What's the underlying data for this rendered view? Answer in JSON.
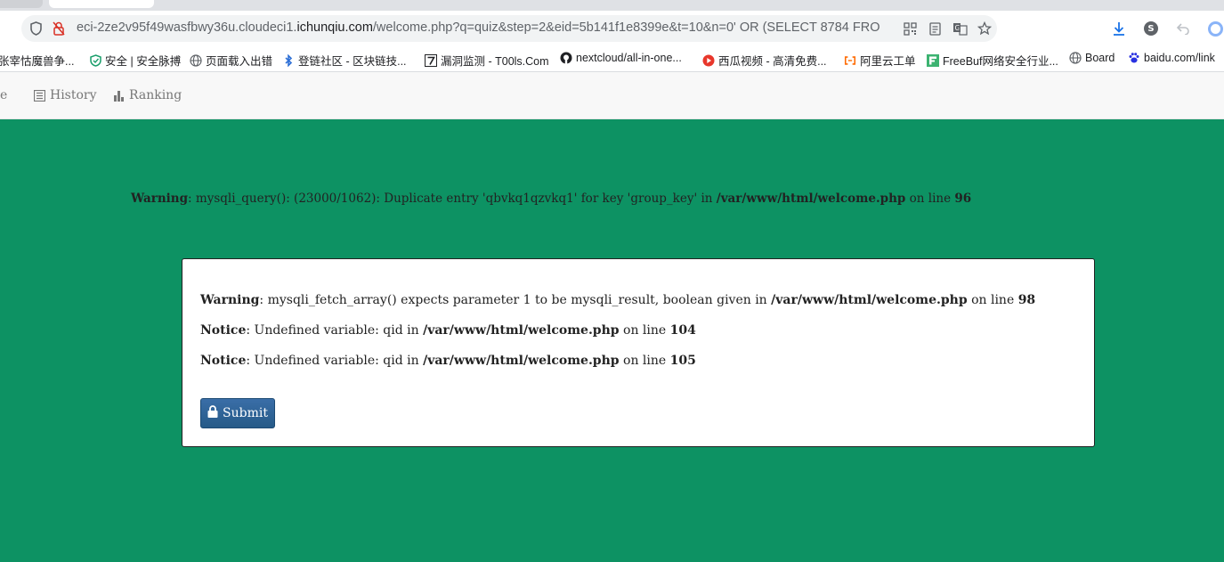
{
  "browser": {
    "url_prefix": "eci-2ze2v95f49wasfbwy36u.cloudeci1.",
    "url_domain": "ichunqiu.com",
    "url_path": "/welcome.php?q=quiz&step=2&eid=5b141f1e8399e&t=10&n=0' OR (SELECT 8784 FRO",
    "profile_initial": "S"
  },
  "bookmarks": [
    {
      "label": "张宰怙魔兽争...",
      "icon": "none"
    },
    {
      "label": "安全 | 安全脉搏",
      "icon": "shield-icon"
    },
    {
      "label": "页面载入出错",
      "icon": "globe-icon"
    },
    {
      "label": "登链社区 - 区块链技...",
      "icon": "bluetooth-icon"
    },
    {
      "label": "漏洞监测 - T00ls.Com",
      "icon": "seven-icon"
    },
    {
      "label": "nextcloud/all-in-one...",
      "icon": "github-icon"
    },
    {
      "label": "西瓜视频 - 高清免费...",
      "icon": "play-icon"
    },
    {
      "label": "阿里云工单",
      "icon": "aliyun-icon"
    },
    {
      "label": "FreeBuf网络安全行业...",
      "icon": "freebuf-icon"
    },
    {
      "label": "Board",
      "icon": "globe-icon"
    },
    {
      "label": "baidu.com/link",
      "icon": "paw-icon"
    }
  ],
  "nav": {
    "home_partial": "ne",
    "history": "History",
    "ranking": "Ranking"
  },
  "warning_top": {
    "label": "Warning",
    "text": ": mysqli_query(): (23000/1062): Duplicate entry 'qbvkq1qzvkq1' for key 'group_key' in ",
    "path": "/var/www/html/welcome.php",
    "on_line": " on line ",
    "line": "96"
  },
  "messages": [
    {
      "label": "Warning",
      "text": ": mysqli_fetch_array() expects parameter 1 to be mysqli_result, boolean given in ",
      "path": "/var/www/html/welcome.php",
      "on_line": " on line ",
      "line": "98"
    },
    {
      "label": "Notice",
      "text": ": Undefined variable: qid in ",
      "path": "/var/www/html/welcome.php",
      "on_line": " on line ",
      "line": "104"
    },
    {
      "label": "Notice",
      "text": ": Undefined variable: qid in ",
      "path": "/var/www/html/welcome.php",
      "on_line": " on line ",
      "line": "105"
    }
  ],
  "submit_label": "Submit",
  "colors": {
    "background": "#0d9263",
    "button": "#2f6496"
  }
}
